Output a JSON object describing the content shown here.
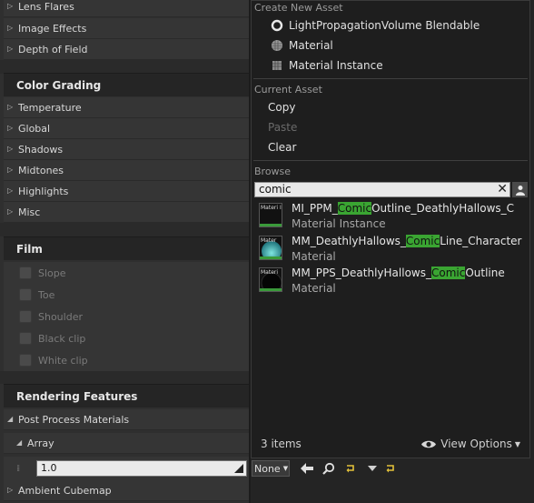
{
  "left_panel": {
    "rows_top": [
      "Lens Flares",
      "Image Effects",
      "Depth of Field"
    ],
    "color_grading": {
      "title": "Color Grading",
      "items": [
        "Temperature",
        "Global",
        "Shadows",
        "Midtones",
        "Highlights",
        "Misc"
      ]
    },
    "film": {
      "title": "Film",
      "checkboxes": [
        "Slope",
        "Toe",
        "Shoulder",
        "Black clip",
        "White clip"
      ]
    },
    "rendering_features": {
      "title": "Rendering Features",
      "post_process": "Post Process Materials",
      "array": "Array",
      "array_value": "1.0",
      "ambient": "Ambient Cubemap"
    }
  },
  "menu": {
    "create_header": "Create New Asset",
    "create_items": [
      {
        "label": "LightPropagationVolume Blendable",
        "icon": "circle-icon"
      },
      {
        "label": "Material",
        "icon": "material-sphere-icon"
      },
      {
        "label": "Material Instance",
        "icon": "material-instance-icon"
      }
    ],
    "current_header": "Current Asset",
    "current_items": [
      {
        "label": "Copy",
        "enabled": true
      },
      {
        "label": "Paste",
        "enabled": false
      },
      {
        "label": "Clear",
        "enabled": true
      }
    ],
    "browse_header": "Browse",
    "search_value": "comic",
    "assets": [
      {
        "pre": "MI_PPM_",
        "hl": "Comic",
        "post": "Outline_DeathlyHallows_C",
        "type": "Material Instance",
        "thumb": "Materi Instan"
      },
      {
        "pre": "MM_DeathlyHallows_",
        "hl": "Comic",
        "post": "Line_Character",
        "type": "Material",
        "thumb": "Mater"
      },
      {
        "pre": "MM_PPS_DeathlyHallows_",
        "hl": "Comic",
        "post": "Outline",
        "type": "Material",
        "thumb": "Materi"
      }
    ],
    "items_count": "3 items",
    "view_options": "View Options"
  },
  "toolbar": {
    "combo_value": "None"
  },
  "colors": {
    "highlight": "#3aa532",
    "panel_bg": "#2f2f2f",
    "menu_bg": "#1e1e1e"
  }
}
